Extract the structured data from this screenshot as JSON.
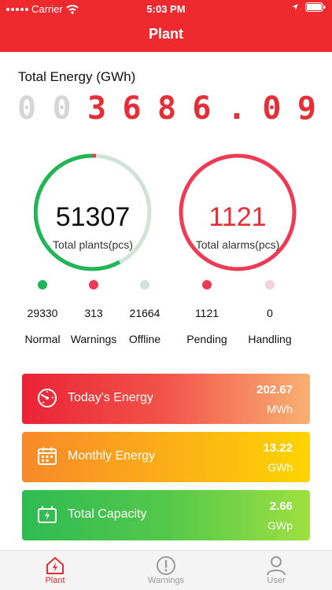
{
  "status_bar": {
    "carrier": "Carrier",
    "time": "5:03 PM"
  },
  "header": {
    "title": "Plant"
  },
  "total_energy": {
    "label": "Total Energy (GWh)",
    "digits": [
      "0",
      "0",
      "3",
      "6",
      "8",
      "6",
      ".",
      "0",
      "9"
    ]
  },
  "plants": {
    "count": "51307",
    "label": "Total plants(pcs)"
  },
  "alarms": {
    "count": "1121",
    "label": "Total alarms(pcs)"
  },
  "legend": [
    {
      "name": "Normal",
      "value": "29330",
      "color": "#22b558"
    },
    {
      "name": "Warnings",
      "value": "313",
      "color": "#ee3a55"
    },
    {
      "name": "Offline",
      "value": "21664",
      "color": "#cfe3d9"
    },
    {
      "name": "Pending",
      "value": "1121",
      "color": "#ee3a55"
    },
    {
      "name": "Handling",
      "value": "0",
      "color": "#f9cfd8"
    }
  ],
  "cards": [
    {
      "title": "Today's Energy",
      "value": "202.67",
      "unit": "MWh",
      "icon": "gauge-icon"
    },
    {
      "title": "Monthly Energy",
      "value": "13.22",
      "unit": "GWh",
      "icon": "calendar-icon"
    },
    {
      "title": "Total Capacity",
      "value": "2.66",
      "unit": "GWp",
      "icon": "battery-icon"
    }
  ],
  "tabs": [
    {
      "label": "Plant",
      "icon": "plant-house-icon"
    },
    {
      "label": "Warnings",
      "icon": "alert-circle-icon"
    },
    {
      "label": "User",
      "icon": "user-icon"
    }
  ],
  "colors": {
    "header": "#ee2a2f",
    "normal": "#22b558",
    "alarm": "#ee3a55",
    "offline": "#cfe3d9"
  }
}
